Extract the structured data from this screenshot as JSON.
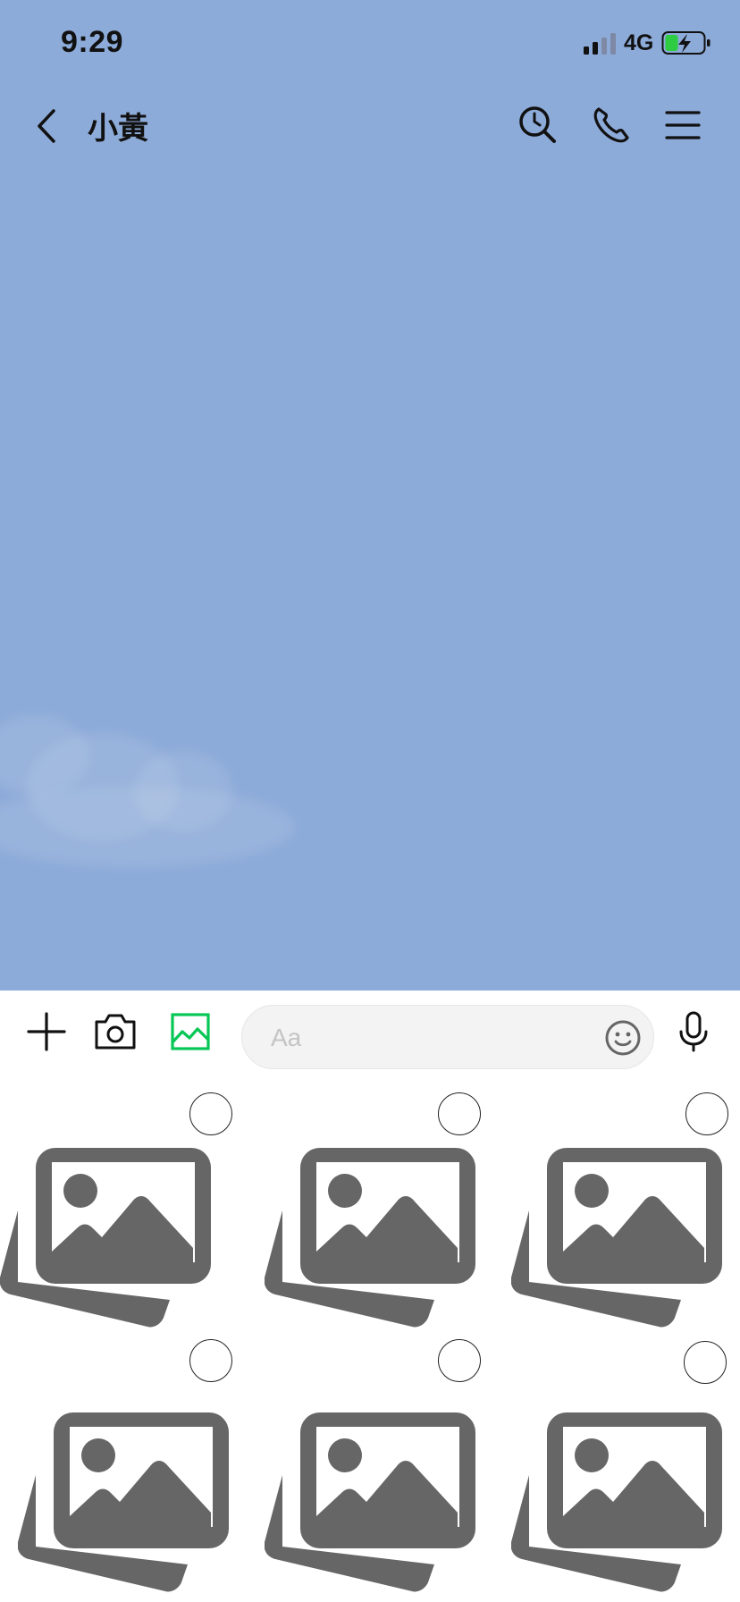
{
  "status_bar": {
    "time": "9:29",
    "network": "4G",
    "icons": [
      "signal-icon",
      "battery-charging-icon"
    ]
  },
  "header": {
    "title": "小黃",
    "icons": [
      "back-arrow-icon",
      "search-history-icon",
      "phone-icon",
      "menu-icon"
    ]
  },
  "input_bar": {
    "placeholder": "Aa",
    "icons": [
      "plus-icon",
      "camera-icon",
      "photo-icon",
      "emoji-icon",
      "microphone-icon"
    ],
    "accent_color": "#06c755"
  },
  "gallery": {
    "item_icon": "photo-placeholder-icon",
    "items": [
      {
        "selected": false
      },
      {
        "selected": false
      },
      {
        "selected": false
      },
      {
        "selected": false
      },
      {
        "selected": false
      },
      {
        "selected": false
      }
    ]
  },
  "colors": {
    "chat_background": "#8dabd9",
    "placeholder_gray": "#666666"
  }
}
